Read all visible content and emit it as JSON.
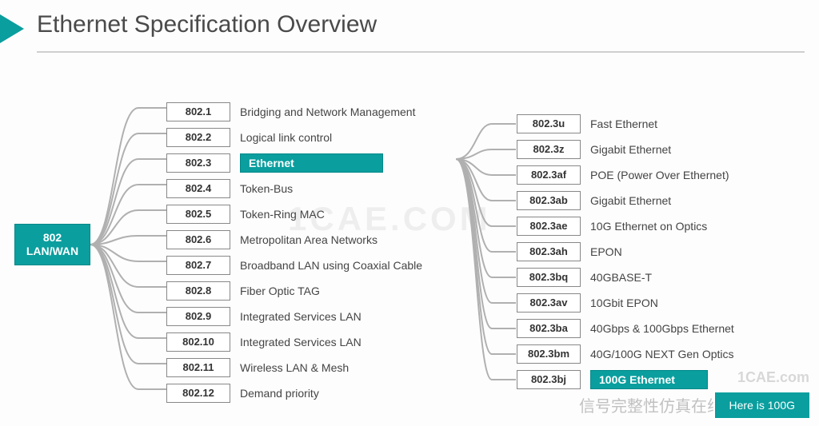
{
  "title": "Ethernet Specification Overview",
  "root": {
    "line1": "802",
    "line2": "LAN/WAN"
  },
  "column1": [
    {
      "code": "802.1",
      "label": "Bridging and Network Management"
    },
    {
      "code": "802.2",
      "label": "Logical link control"
    },
    {
      "code": "802.3",
      "label": "Ethernet",
      "highlight": true
    },
    {
      "code": "802.4",
      "label": "Token-Bus"
    },
    {
      "code": "802.5",
      "label": "Token-Ring MAC"
    },
    {
      "code": "802.6",
      "label": "Metropolitan Area Networks"
    },
    {
      "code": "802.7",
      "label": "Broadband LAN using Coaxial Cable"
    },
    {
      "code": "802.8",
      "label": "Fiber Optic TAG"
    },
    {
      "code": "802.9",
      "label": "Integrated Services LAN"
    },
    {
      "code": "802.10",
      "label": "Integrated Services LAN"
    },
    {
      "code": "802.11",
      "label": "Wireless LAN & Mesh"
    },
    {
      "code": "802.12",
      "label": "Demand priority"
    }
  ],
  "column2": [
    {
      "code": "802.3u",
      "label": "Fast Ethernet"
    },
    {
      "code": "802.3z",
      "label": "Gigabit Ethernet"
    },
    {
      "code": "802.3af",
      "label": "POE (Power Over Ethernet)"
    },
    {
      "code": "802.3ab",
      "label": "Gigabit Ethernet"
    },
    {
      "code": "802.3ae",
      "label": "10G Ethernet on Optics"
    },
    {
      "code": "802.3ah",
      "label": "EPON"
    },
    {
      "code": "802.3bq",
      "label": "40GBASE-T"
    },
    {
      "code": "802.3av",
      "label": "10Gbit EPON"
    },
    {
      "code": "802.3ba",
      "label": "40Gbps & 100Gbps Ethernet"
    },
    {
      "code": "802.3bm",
      "label": "40G/100G NEXT Gen Optics"
    },
    {
      "code": "802.3bj",
      "label": "100G Ethernet",
      "highlight": true
    }
  ],
  "callout": "Here is 100G",
  "watermarks": {
    "center": "1CAE.COM",
    "right": "1CAE.com",
    "bottom": "信号完整性仿真在线"
  }
}
